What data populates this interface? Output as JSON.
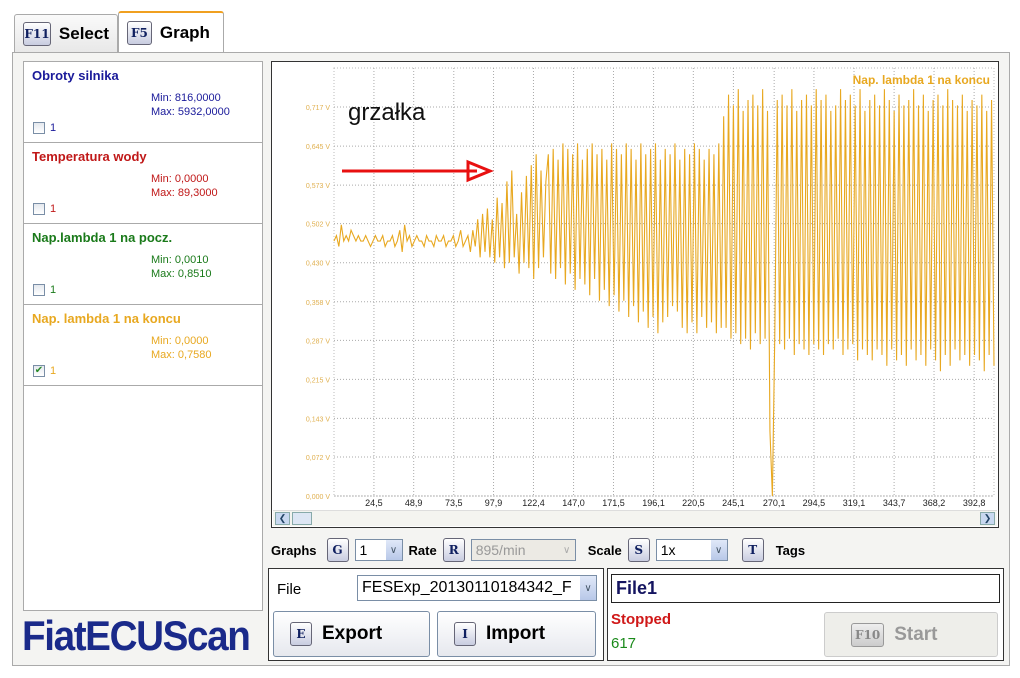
{
  "tabs": [
    {
      "key": "F11",
      "label": "Select"
    },
    {
      "key": "F5",
      "label": "Graph",
      "active": true
    }
  ],
  "signals": [
    {
      "name": "Obroty silnika",
      "min": "Min: 816,0000",
      "max": "Max: 5932,0000",
      "checkbox_label": "1",
      "checked": false,
      "color": "#1a1a9a"
    },
    {
      "name": "Temperatura wody",
      "min": "Min: 0,0000",
      "max": "Max: 89,3000",
      "checkbox_label": "1",
      "checked": false,
      "color": "#c01818"
    },
    {
      "name": "Nap.lambda 1 na pocz.",
      "min": "Min: 0,0010",
      "max": "Max: 0,8510",
      "checkbox_label": "1",
      "checked": false,
      "color": "#1a7a1a"
    },
    {
      "name": "Nap. lambda 1 na koncu",
      "min": "Min: 0,0000",
      "max": "Max: 0,7580",
      "checkbox_label": "1",
      "checked": true,
      "color": "#e8a820"
    }
  ],
  "logo": "FiatECUScan",
  "annotation": {
    "text": "grzałka",
    "arrow_color": "#e81010"
  },
  "controls": {
    "graphs_label": "Graphs",
    "graphs_key": "G",
    "graphs_value": "1",
    "rate_label": "Rate",
    "rate_key": "R",
    "rate_value": "895/min",
    "scale_label": "Scale",
    "scale_key": "S",
    "scale_value": "1x",
    "tags_key": "T",
    "tags_label": "Tags"
  },
  "file": {
    "label": "File",
    "value": "FESExp_20130110184342_F",
    "export_key": "E",
    "export_label": "Export",
    "import_key": "I",
    "import_label": "Import"
  },
  "status": {
    "file_name": "File1",
    "state": "Stopped",
    "count": "617",
    "start_key": "F10",
    "start_label": "Start"
  },
  "chart_data": {
    "type": "line",
    "legend": "Nap. lambda 1 na koncu",
    "legend_position": "top-right",
    "series_color": "#e8a820",
    "ylim": [
      0,
      0.789
    ],
    "xlim": [
      0,
      405
    ],
    "y_ticks": [
      "0,000 V",
      "0,072 V",
      "0,143 V",
      "0,215 V",
      "0,287 V",
      "0,358 V",
      "0,430 V",
      "0,502 V",
      "0,573 V",
      "0,645 V",
      "0,717 V"
    ],
    "y_tick_values": [
      0,
      0.072,
      0.143,
      0.215,
      0.287,
      0.358,
      0.43,
      0.502,
      0.573,
      0.645,
      0.717
    ],
    "x_ticks": [
      "24,5",
      "48,9",
      "73,5",
      "97,9",
      "122,4",
      "147,0",
      "171,5",
      "196,1",
      "220,5",
      "245,1",
      "270,1",
      "294,5",
      "319,1",
      "343,7",
      "368,2",
      "392,8"
    ],
    "x_tick_values": [
      24.5,
      48.9,
      73.5,
      97.9,
      122.4,
      147.0,
      171.5,
      196.1,
      220.5,
      245.1,
      270.1,
      294.5,
      319.1,
      343.7,
      368.2,
      392.8
    ],
    "grid": true,
    "x_step": 1.7,
    "values": [
      0.47,
      0.48,
      0.46,
      0.5,
      0.47,
      0.48,
      0.47,
      0.49,
      0.48,
      0.47,
      0.48,
      0.47,
      0.47,
      0.48,
      0.47,
      0.46,
      0.47,
      0.48,
      0.47,
      0.47,
      0.48,
      0.46,
      0.47,
      0.47,
      0.48,
      0.46,
      0.47,
      0.49,
      0.45,
      0.5,
      0.47,
      0.48,
      0.46,
      0.47,
      0.48,
      0.47,
      0.47,
      0.46,
      0.48,
      0.47,
      0.47,
      0.46,
      0.48,
      0.47,
      0.47,
      0.48,
      0.46,
      0.47,
      0.47,
      0.48,
      0.46,
      0.47,
      0.49,
      0.46,
      0.47,
      0.48,
      0.45,
      0.49,
      0.46,
      0.51,
      0.44,
      0.52,
      0.45,
      0.53,
      0.44,
      0.51,
      0.43,
      0.55,
      0.44,
      0.54,
      0.42,
      0.58,
      0.43,
      0.6,
      0.44,
      0.52,
      0.41,
      0.56,
      0.43,
      0.59,
      0.42,
      0.61,
      0.4,
      0.63,
      0.42,
      0.6,
      0.44,
      0.58,
      0.63,
      0.41,
      0.64,
      0.4,
      0.62,
      0.42,
      0.65,
      0.39,
      0.64,
      0.41,
      0.63,
      0.38,
      0.65,
      0.4,
      0.62,
      0.39,
      0.64,
      0.37,
      0.65,
      0.4,
      0.63,
      0.36,
      0.64,
      0.38,
      0.62,
      0.35,
      0.65,
      0.37,
      0.64,
      0.34,
      0.63,
      0.36,
      0.65,
      0.33,
      0.64,
      0.35,
      0.62,
      0.32,
      0.65,
      0.34,
      0.63,
      0.31,
      0.64,
      0.33,
      0.65,
      0.3,
      0.62,
      0.32,
      0.64,
      0.33,
      0.63,
      0.35,
      0.65,
      0.34,
      0.62,
      0.31,
      0.64,
      0.3,
      0.63,
      0.32,
      0.65,
      0.3,
      0.64,
      0.33,
      0.62,
      0.31,
      0.64,
      0.32,
      0.63,
      0.3,
      0.65,
      0.31,
      0.7,
      0.31,
      0.74,
      0.29,
      0.72,
      0.3,
      0.75,
      0.28,
      0.71,
      0.29,
      0.73,
      0.27,
      0.74,
      0.3,
      0.72,
      0.28,
      0.75,
      0.29,
      0.71,
      0.12,
      0.0,
      0.3,
      0.73,
      0.28,
      0.74,
      0.27,
      0.72,
      0.29,
      0.75,
      0.26,
      0.71,
      0.28,
      0.73,
      0.27,
      0.74,
      0.26,
      0.72,
      0.28,
      0.75,
      0.27,
      0.73,
      0.26,
      0.74,
      0.28,
      0.71,
      0.27,
      0.72,
      0.29,
      0.75,
      0.26,
      0.73,
      0.27,
      0.74,
      0.28,
      0.72,
      0.25,
      0.75,
      0.27,
      0.71,
      0.26,
      0.73,
      0.25,
      0.74,
      0.27,
      0.72,
      0.26,
      0.75,
      0.24,
      0.73,
      0.27,
      0.71,
      0.25,
      0.74,
      0.26,
      0.72,
      0.24,
      0.73,
      0.27,
      0.75,
      0.25,
      0.72,
      0.26,
      0.74,
      0.24,
      0.71,
      0.27,
      0.73,
      0.25,
      0.74,
      0.23,
      0.72,
      0.26,
      0.75,
      0.24,
      0.73,
      0.27,
      0.72,
      0.25,
      0.74,
      0.26,
      0.71,
      0.24,
      0.73,
      0.26,
      0.72,
      0.25,
      0.74,
      0.23,
      0.71,
      0.26,
      0.73,
      0.24
    ]
  }
}
